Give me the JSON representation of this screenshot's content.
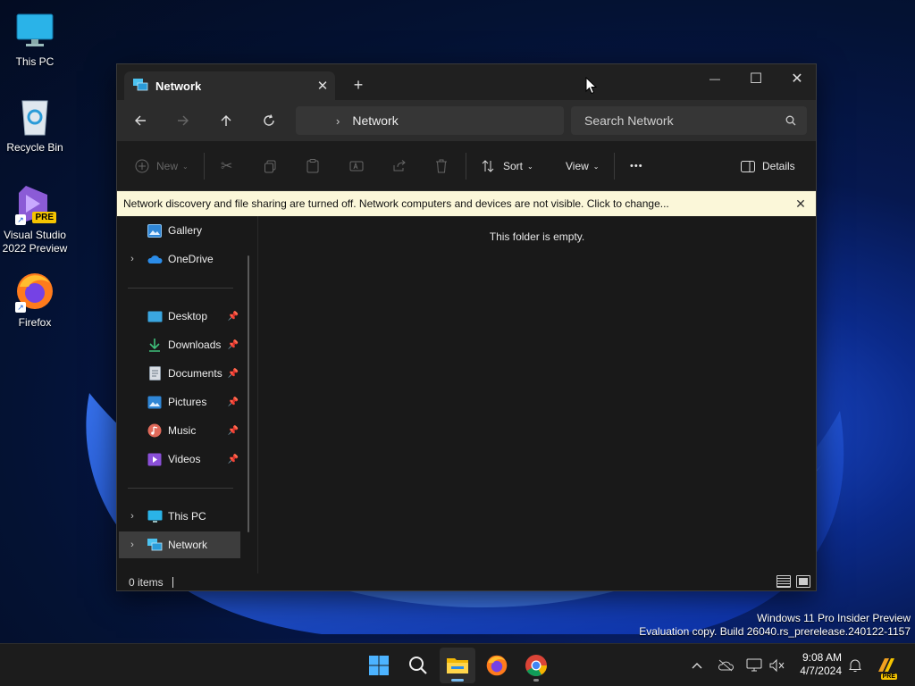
{
  "desktop": {
    "icons": [
      {
        "label": "This PC"
      },
      {
        "label": "Recycle Bin"
      },
      {
        "label": "Visual Studio 2022 Preview",
        "badge": "PRE"
      },
      {
        "label": "Firefox"
      }
    ]
  },
  "window": {
    "tab_title": "Network",
    "tab_close": "✕",
    "new_tab": "+",
    "controls": {
      "minimize": "—",
      "maximize": "☐",
      "close": "✕"
    },
    "address": {
      "location": "Network"
    },
    "search": {
      "placeholder": "Search Network"
    },
    "commands": {
      "new_label": "New",
      "sort_label": "Sort",
      "view_label": "View",
      "more_label": "•••",
      "details_label": "Details"
    },
    "infobar": {
      "message": "Network discovery and file sharing are turned off. Network computers and devices are not visible. Click to change...",
      "close": "✕"
    },
    "sidebar": {
      "items": [
        {
          "label": "Gallery"
        },
        {
          "label": "OneDrive"
        },
        {
          "label": "Desktop"
        },
        {
          "label": "Downloads"
        },
        {
          "label": "Documents"
        },
        {
          "label": "Pictures"
        },
        {
          "label": "Music"
        },
        {
          "label": "Videos"
        },
        {
          "label": "This PC"
        },
        {
          "label": "Network"
        }
      ]
    },
    "content": {
      "empty_message": "This folder is empty."
    },
    "status": {
      "items_count": "0 items"
    }
  },
  "watermark": {
    "line1": "Windows 11 Pro Insider Preview",
    "line2": "Evaluation copy. Build 26040.rs_prerelease.240122-1157"
  },
  "taskbar": {
    "time": "9:08 AM",
    "date": "4/7/2024",
    "tray_badge": "PRE"
  },
  "colors": {
    "infobar_bg": "#fbf7d9",
    "window_bg": "#191919",
    "accent": "#76b9ed"
  }
}
